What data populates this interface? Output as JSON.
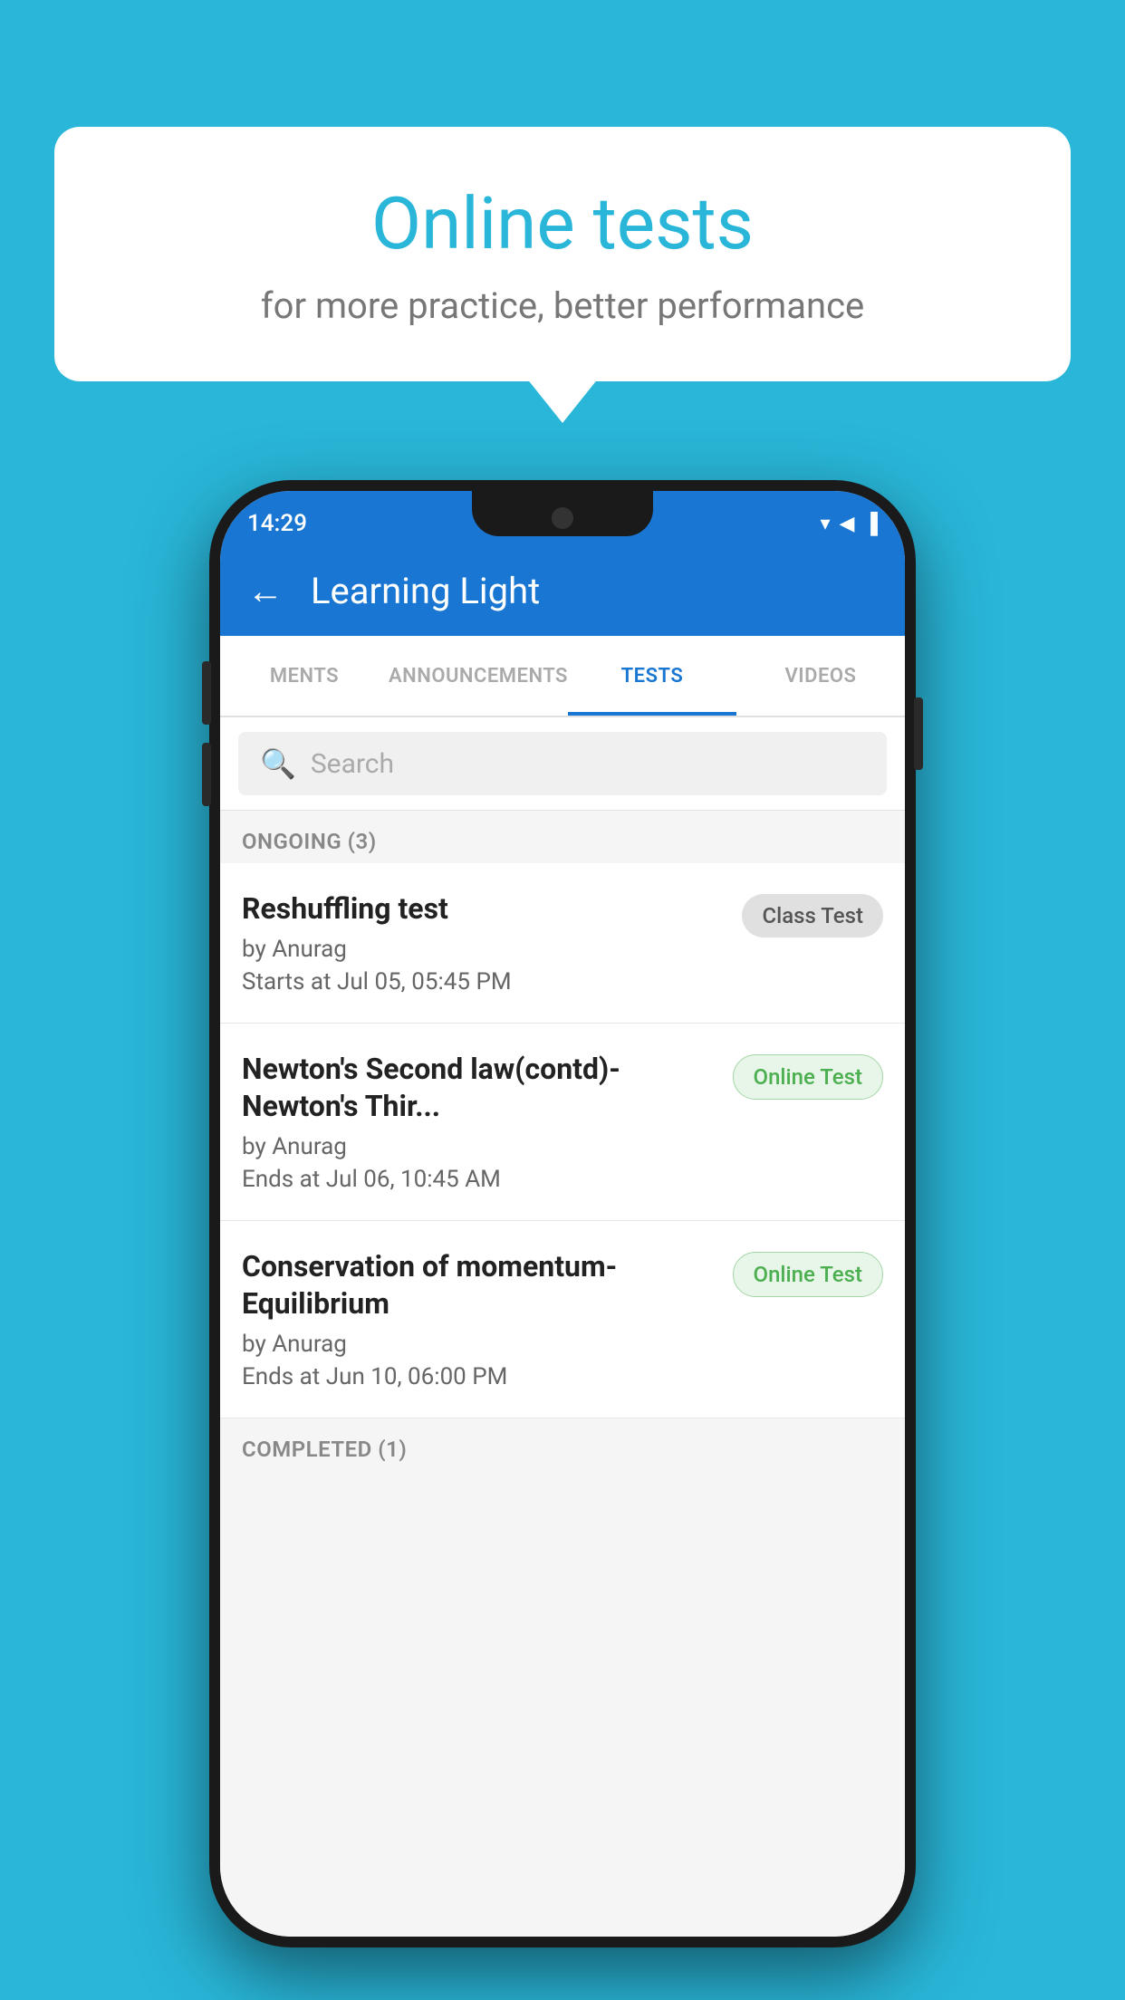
{
  "background": {
    "color": "#29b6d8"
  },
  "speech_bubble": {
    "title": "Online tests",
    "subtitle": "for more practice, better performance"
  },
  "phone": {
    "status_bar": {
      "time": "14:29",
      "icons": [
        "▼",
        "▲",
        "▐"
      ]
    },
    "app_bar": {
      "title": "Learning Light",
      "back_label": "←"
    },
    "tabs": [
      {
        "label": "MENTS",
        "active": false
      },
      {
        "label": "ANNOUNCEMENTS",
        "active": false
      },
      {
        "label": "TESTS",
        "active": true
      },
      {
        "label": "VIDEOS",
        "active": false
      }
    ],
    "search": {
      "placeholder": "Search"
    },
    "ongoing_section": {
      "header": "ONGOING (3)",
      "tests": [
        {
          "name": "Reshuffling test",
          "author": "by Anurag",
          "date": "Starts at  Jul 05, 05:45 PM",
          "badge": "Class Test",
          "badge_type": "class"
        },
        {
          "name": "Newton's Second law(contd)-Newton's Thir...",
          "author": "by Anurag",
          "date": "Ends at  Jul 06, 10:45 AM",
          "badge": "Online Test",
          "badge_type": "online"
        },
        {
          "name": "Conservation of momentum-Equilibrium",
          "author": "by Anurag",
          "date": "Ends at  Jun 10, 06:00 PM",
          "badge": "Online Test",
          "badge_type": "online"
        }
      ]
    },
    "completed_section": {
      "header": "COMPLETED (1)"
    }
  }
}
